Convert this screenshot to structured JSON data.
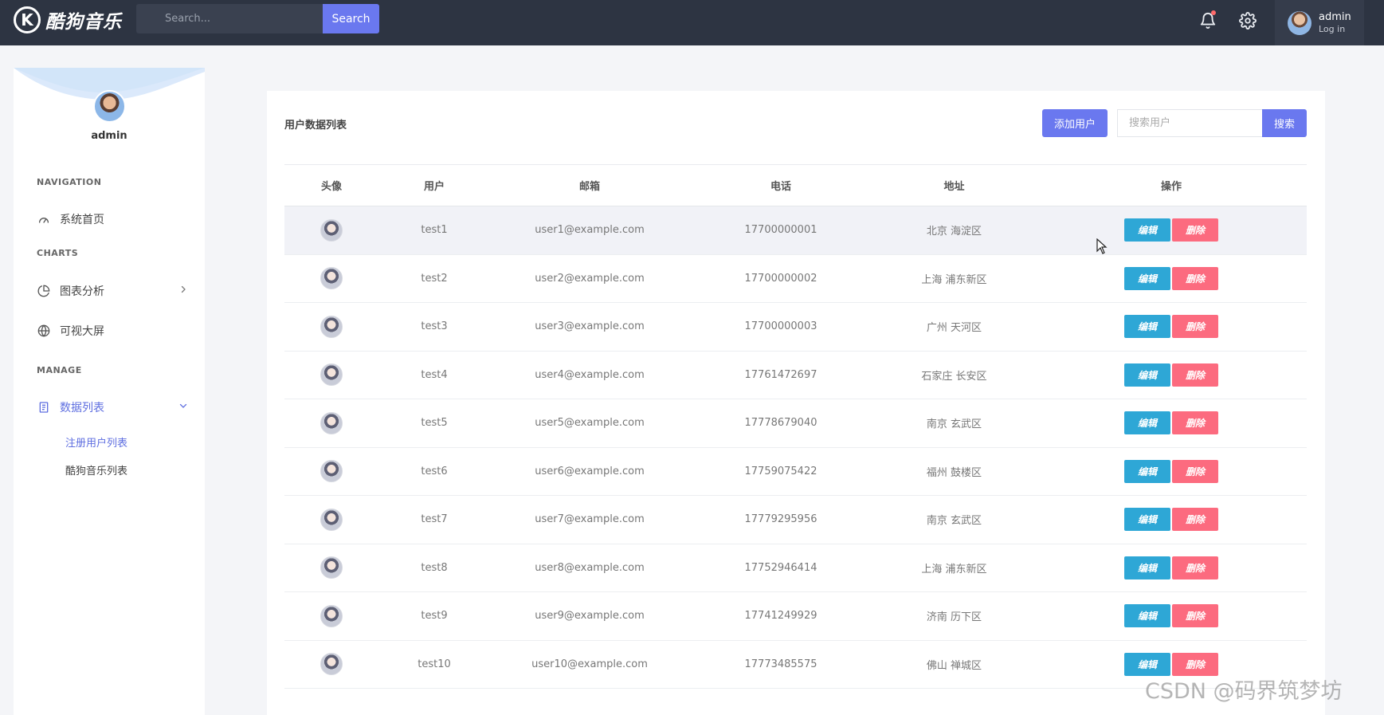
{
  "app": {
    "brand_letter": "K",
    "brand_name": "酷狗音乐",
    "search_placeholder": "Search...",
    "search_button": "Search"
  },
  "user_menu": {
    "name": "admin",
    "sub": "Log in"
  },
  "sidebar": {
    "profile_name": "admin",
    "sections": {
      "navigation": "NAVIGATION",
      "charts": "CHARTS",
      "manage": "MANAGE"
    },
    "items": {
      "home": "系统首页",
      "analysis": "图表分析",
      "screen": "可视大屏",
      "data_list": "数据列表"
    },
    "sub_items": {
      "registered_users": "注册用户列表",
      "music_list": "酷狗音乐列表"
    }
  },
  "main": {
    "title": "用户数据列表",
    "add_button": "添加用户",
    "search_placeholder": "搜索用户",
    "search_button": "搜索",
    "columns": [
      "头像",
      "用户",
      "邮箱",
      "电话",
      "地址",
      "操作"
    ],
    "edit_label": "编辑",
    "delete_label": "删除",
    "rows": [
      {
        "user": "test1",
        "email": "user1@example.com",
        "phone": "17700000001",
        "address": "北京 海淀区"
      },
      {
        "user": "test2",
        "email": "user2@example.com",
        "phone": "17700000002",
        "address": "上海 浦东新区"
      },
      {
        "user": "test3",
        "email": "user3@example.com",
        "phone": "17700000003",
        "address": "广州 天河区"
      },
      {
        "user": "test4",
        "email": "user4@example.com",
        "phone": "17761472697",
        "address": "石家庄 长安区"
      },
      {
        "user": "test5",
        "email": "user5@example.com",
        "phone": "17778679040",
        "address": "南京 玄武区"
      },
      {
        "user": "test6",
        "email": "user6@example.com",
        "phone": "17759075422",
        "address": "福州 鼓楼区"
      },
      {
        "user": "test7",
        "email": "user7@example.com",
        "phone": "17779295956",
        "address": "南京 玄武区"
      },
      {
        "user": "test8",
        "email": "user8@example.com",
        "phone": "17752946414",
        "address": "上海 浦东新区"
      },
      {
        "user": "test9",
        "email": "user9@example.com",
        "phone": "17741249929",
        "address": "济南 历下区"
      },
      {
        "user": "test10",
        "email": "user10@example.com",
        "phone": "17773485575",
        "address": "佛山 禅城区"
      }
    ]
  },
  "watermark": "CSDN @码界筑梦坊",
  "colors": {
    "topbar": "#2d3442",
    "accent": "#6a78ef",
    "edit": "#2ea7d6",
    "delete": "#fc6b7f",
    "active_link": "#5e6ee0"
  }
}
